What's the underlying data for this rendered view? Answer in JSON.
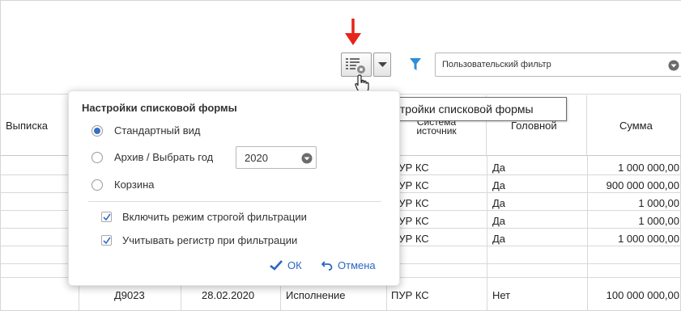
{
  "toolbar": {
    "settings_button_icon": "list-settings-icon",
    "dropdown_icon": "caret-down-icon",
    "filter_icon": "funnel-icon",
    "filter_select_value": "Пользовательский фильтр",
    "annotation_arrow_color": "#e8231b",
    "filter_icon_color": "#2d8fd6"
  },
  "tooltip": {
    "text": "Настройки списковой формы"
  },
  "table": {
    "headers": {
      "vypiska": "Выписка",
      "sistema": "Система источник",
      "golovnoy": "Головной",
      "summa": "Сумма"
    },
    "rows": [
      {
        "sistema": "ПУР КС",
        "golovnoy": "Да",
        "summa": "1 000 000,00"
      },
      {
        "sistema": "ПУР КС",
        "golovnoy": "Да",
        "summa": "900 000 000,00"
      },
      {
        "sistema": "ПУР КС",
        "golovnoy": "Да",
        "summa": "1 000,00"
      },
      {
        "sistema": "ПУР КС",
        "golovnoy": "Да",
        "summa": "1 000,00"
      },
      {
        "sistema": "ПУР КС",
        "golovnoy": "Да",
        "summa": "1 000 000,00"
      }
    ],
    "last_row": {
      "doc": "Д9023",
      "date": "28.02.2020",
      "status": "Исполнение",
      "sistema": "ПУР КС",
      "golovnoy": "Нет",
      "summa": "100 000 000,00"
    }
  },
  "popup": {
    "title": "Настройки списковой формы",
    "options": [
      {
        "label": "Стандартный вид",
        "selected": true
      },
      {
        "label": "Архив / Выбрать год",
        "selected": false
      },
      {
        "label": "Корзина",
        "selected": false
      }
    ],
    "year_value": "2020",
    "checkboxes": [
      {
        "label": "Включить режим строгой фильтрации",
        "checked": true
      },
      {
        "label": "Учитывать регистр при фильтрации",
        "checked": true
      }
    ],
    "ok_label": "ОК",
    "cancel_label": "Отмена",
    "accent_color": "#2b66c2"
  }
}
